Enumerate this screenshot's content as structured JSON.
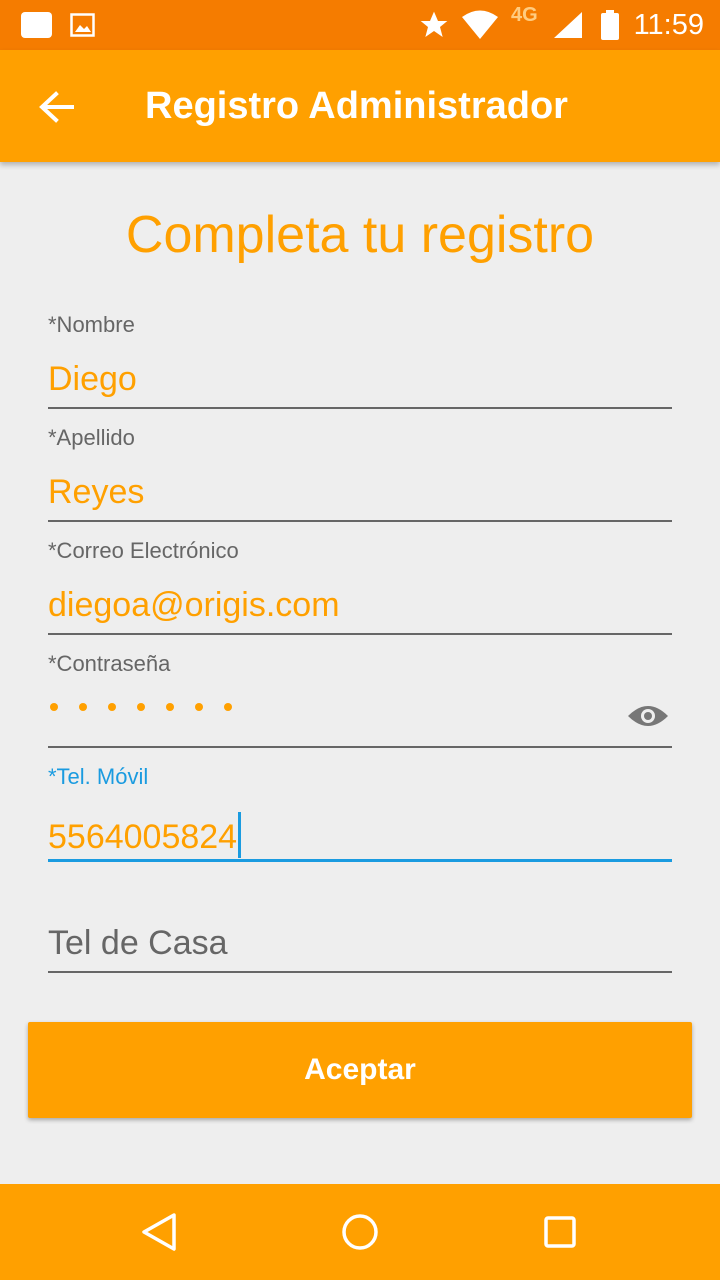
{
  "status_bar": {
    "network": "4G",
    "time": "11:59",
    "icons": [
      "notification-icon",
      "image-icon",
      "star-icon",
      "wifi-icon",
      "signal-icon",
      "battery-icon"
    ]
  },
  "app_bar": {
    "title": "Registro Administrador",
    "back_icon": "arrow-back-icon"
  },
  "form": {
    "heading": "Completa tu registro",
    "fields": [
      {
        "label": "*Nombre",
        "value": "Diego"
      },
      {
        "label": "*Apellido",
        "value": "Reyes"
      },
      {
        "label": "*Correo Electrónico",
        "value": "diegoa@origis.com"
      },
      {
        "label": "*Contraseña",
        "value": "•••••••",
        "toggle_icon": "eye-icon"
      },
      {
        "label": "*Tel. Móvil",
        "value": "5564005824",
        "focused": true
      },
      {
        "label": "",
        "placeholder": "Tel de Casa",
        "value": ""
      }
    ],
    "submit_label": "Aceptar"
  },
  "nav_bar": {
    "icons": [
      "back-triangle-icon",
      "home-circle-icon",
      "recents-square-icon"
    ]
  },
  "colors": {
    "status_bar": "#f57c00",
    "accent": "#ffa000",
    "focus": "#1a9be0",
    "background": "#eeeeee"
  }
}
